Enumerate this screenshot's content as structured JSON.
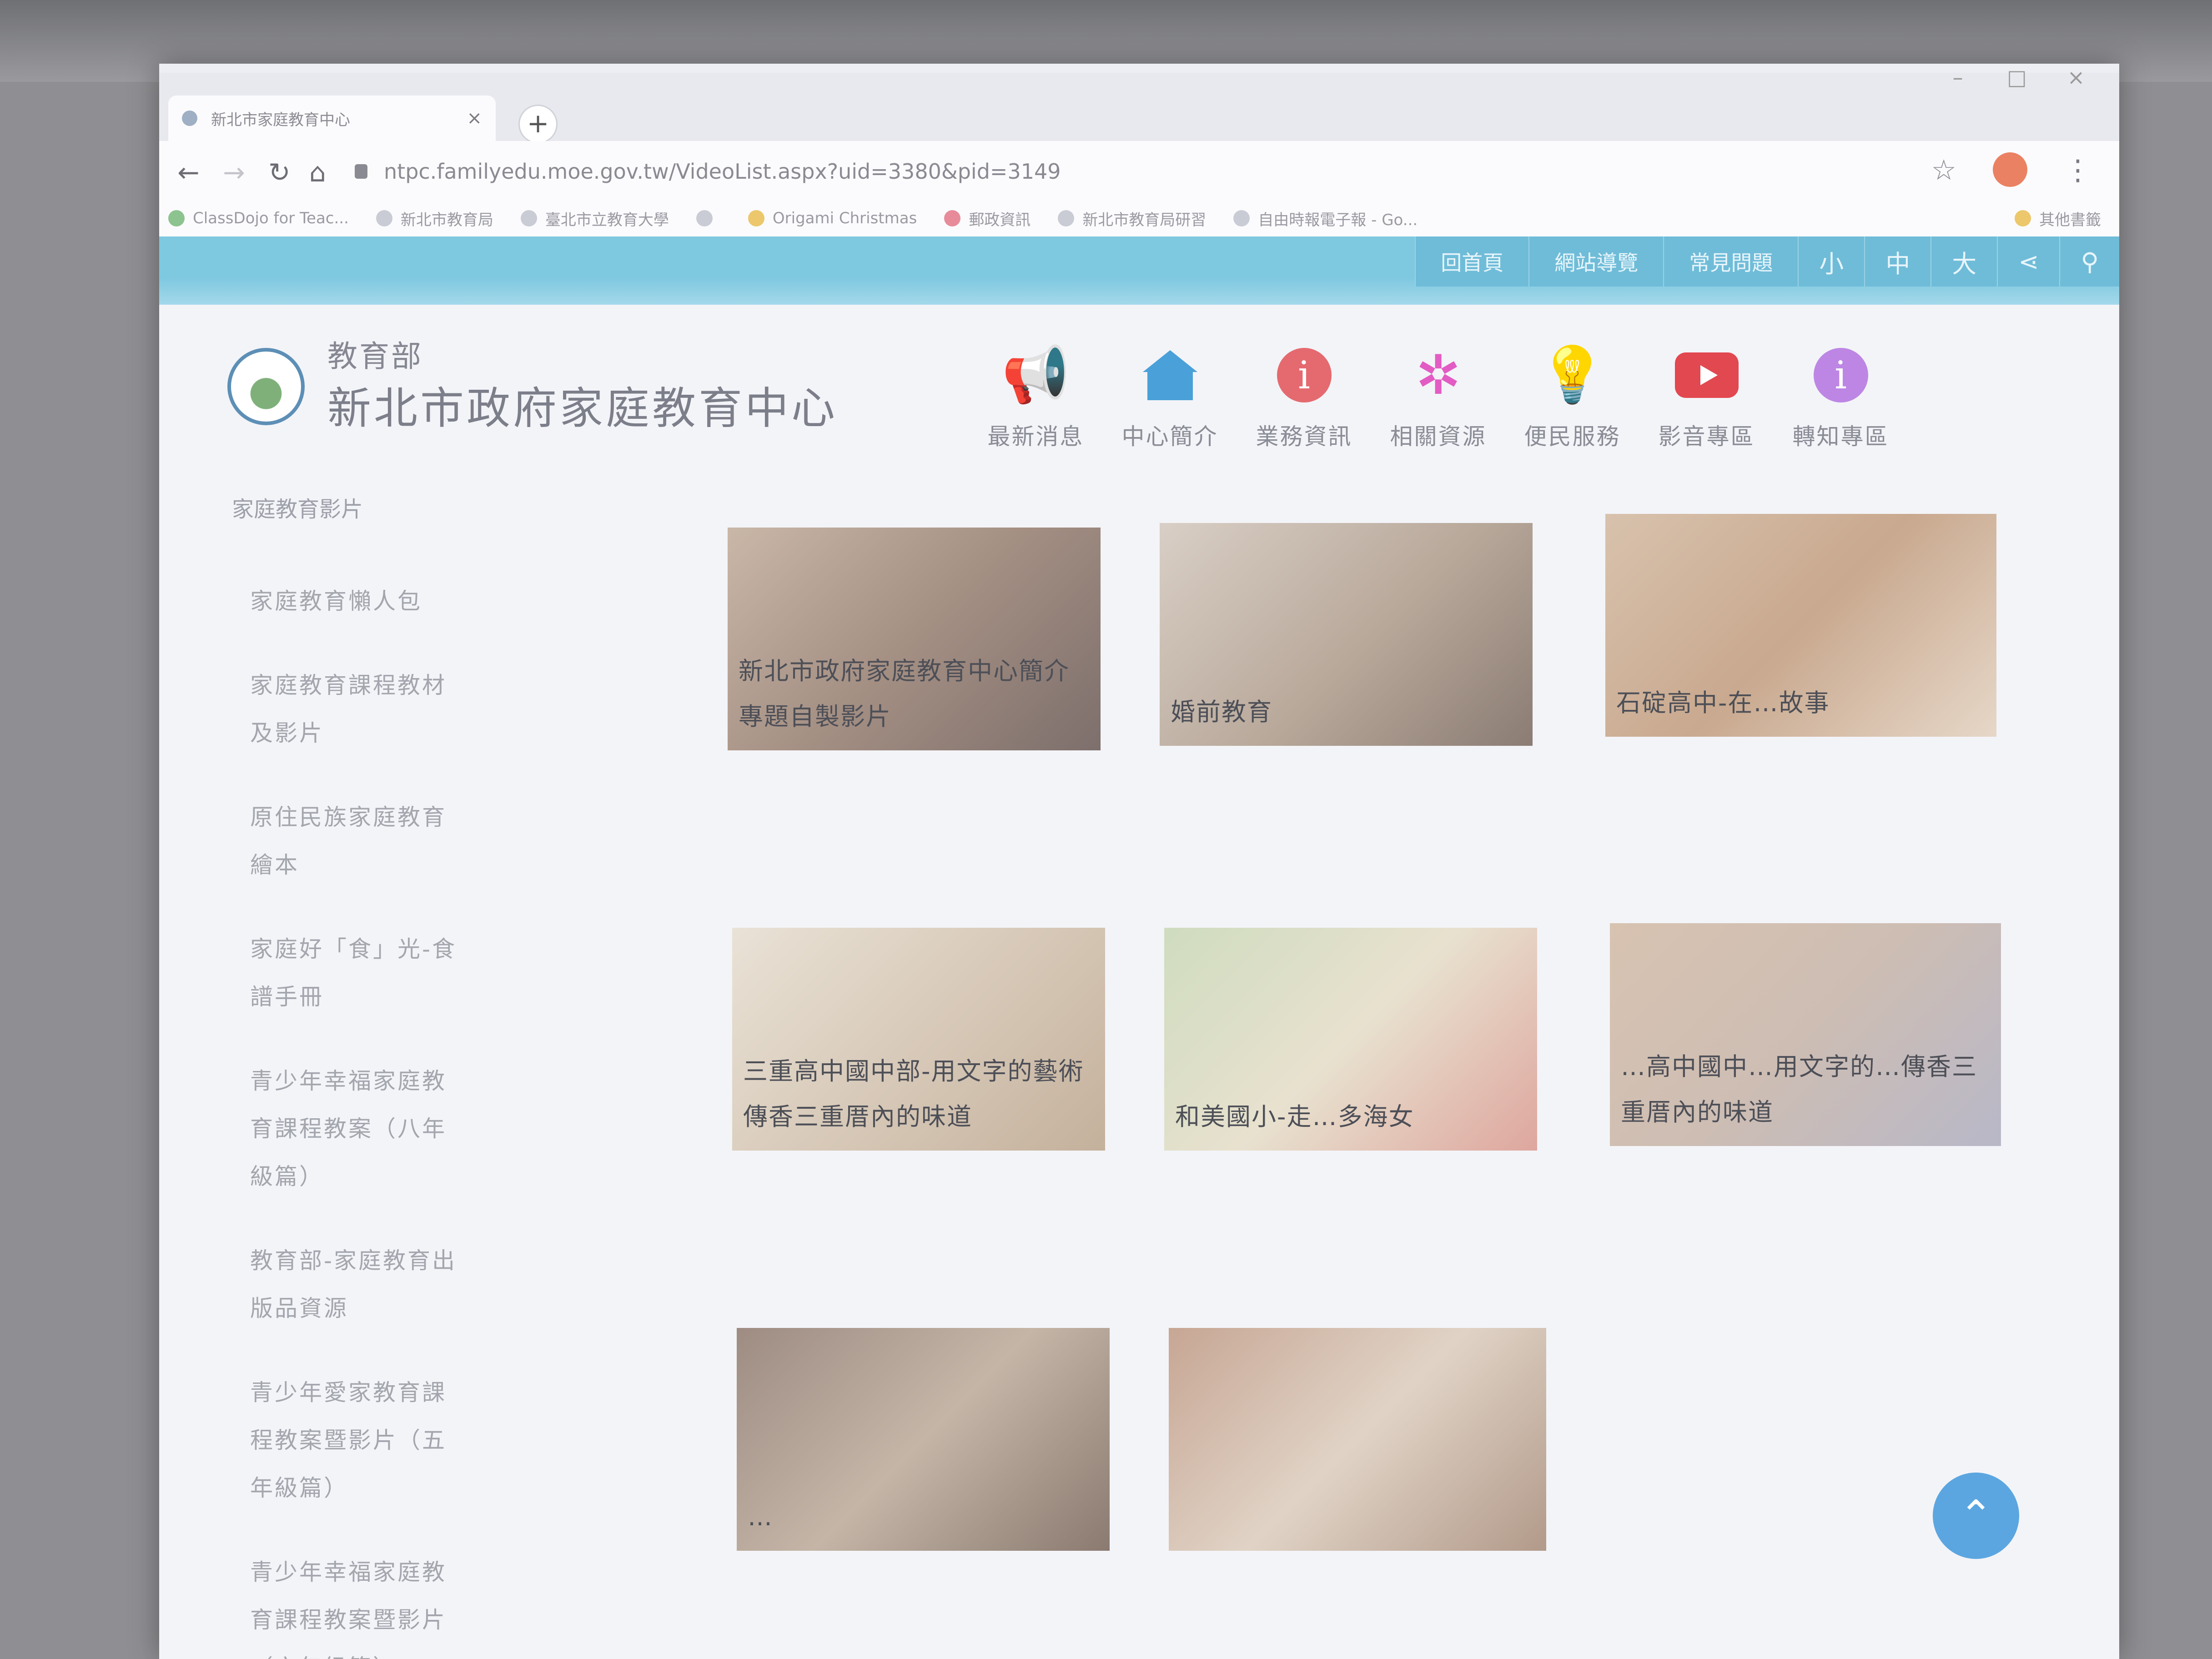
{
  "browser": {
    "tab_title": "新北市家庭教育中心",
    "url": "ntpc.familyedu.moe.gov.tw/VideoList.aspx?uid=3380&pid=3149",
    "bookmarks": [
      {
        "label": "ClassDojo for Teac..."
      },
      {
        "label": "新北市教育局"
      },
      {
        "label": "臺北市立教育大學"
      },
      {
        "label": ""
      },
      {
        "label": "Origami Christmas"
      },
      {
        "label": "郵政資訊"
      },
      {
        "label": "新北市教育局研習"
      },
      {
        "label": "自由時報電子報 - Go..."
      }
    ],
    "other_bookmarks": "其他書籤"
  },
  "topnav": {
    "items": [
      "回首頁",
      "網站導覽",
      "常見問題"
    ],
    "font_small": "小",
    "font_medium": "中",
    "font_large": "大"
  },
  "header": {
    "org": "教育部",
    "site_name": "新北市政府家庭教育中心"
  },
  "main_menu": [
    {
      "label": "最新消息",
      "icon": "megaphone-icon"
    },
    {
      "label": "中心簡介",
      "icon": "home-heart-icon"
    },
    {
      "label": "業務資訊",
      "icon": "info-icon"
    },
    {
      "label": "相關資源",
      "icon": "network-icon"
    },
    {
      "label": "便民服務",
      "icon": "lightbulb-icon"
    },
    {
      "label": "影音專區",
      "icon": "youtube-icon"
    },
    {
      "label": "轉知專區",
      "icon": "info-bubble-icon"
    }
  ],
  "sidebar": {
    "breadcrumb": "家庭教育影片",
    "items": [
      "家庭教育懶人包",
      "家庭教育課程教材及影片",
      "原住民族家庭教育繪本",
      "家庭好「食」光-食譜手冊",
      "青少年幸福家庭教育課程教案（八年級篇）",
      "教育部-家庭教育出版品資源",
      "青少年愛家教育課程教案暨影片（五年級篇）",
      "青少年幸福家庭教育課程教案暨影片（六年級篇）"
    ]
  },
  "videos": [
    {
      "caption": "新北市政府家庭教育中心簡介專題自製影片"
    },
    {
      "caption": "婚前教育"
    },
    {
      "caption": "石碇高中-在…故事"
    },
    {
      "caption": "三重高中國中部-用文字的藝術傳香三重厝內的味道"
    },
    {
      "caption": "和美國小-走…多海女"
    },
    {
      "caption": "…高中國中…用文字的…傳香三重厝內的味道"
    },
    {
      "caption": "…"
    },
    {
      "caption": ""
    }
  ],
  "colors": {
    "accent": "#7ec8e0",
    "fab": "#5ba6e0"
  }
}
